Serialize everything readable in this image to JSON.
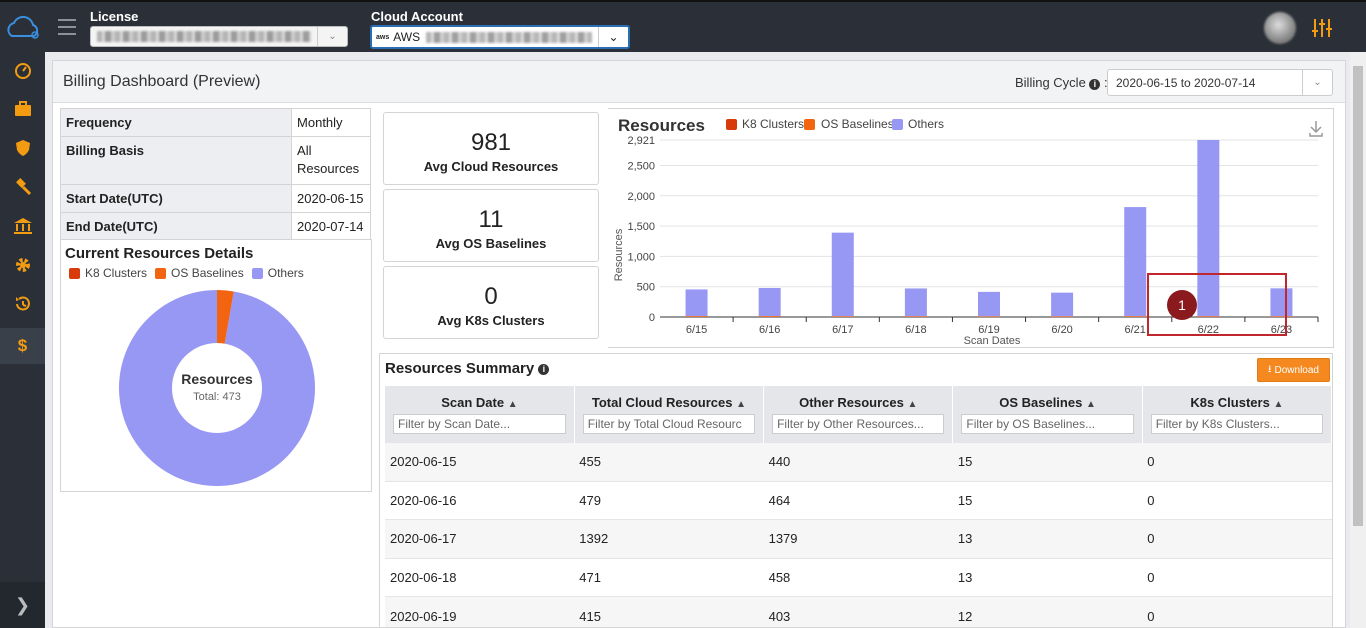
{
  "topbar": {
    "license_label": "License",
    "cloud_account_label": "Cloud Account",
    "cloud_account_value": "AWS"
  },
  "sidebar": {
    "items": [
      {
        "icon": "speedometer-icon"
      },
      {
        "icon": "briefcase-icon"
      },
      {
        "icon": "shield-icon"
      },
      {
        "icon": "gavel-icon"
      },
      {
        "icon": "bank-icon"
      },
      {
        "icon": "gear-icon"
      },
      {
        "icon": "history-icon"
      },
      {
        "icon": "dollar-icon",
        "active": true
      }
    ],
    "collapse_icon": "chevron-right-icon"
  },
  "header": {
    "title": "Billing Dashboard (Preview)",
    "billing_cycle_label": "Billing Cycle",
    "billing_cycle_value": "2020-06-15 to 2020-07-14"
  },
  "info": {
    "frequency_label": "Frequency",
    "frequency_value": "Monthly",
    "basis_label": "Billing Basis",
    "basis_value": "All Resources",
    "start_label": "Start Date(UTC)",
    "start_value": "2020-06-15",
    "end_label": "End Date(UTC)",
    "end_value": "2020-07-14"
  },
  "donut": {
    "title": "Current Resources Details",
    "legend": [
      "K8 Clusters",
      "OS Baselines",
      "Others"
    ],
    "center_title": "Resources",
    "center_sub": "Total: 473"
  },
  "stats": [
    {
      "value": "981",
      "label": "Avg Cloud Resources"
    },
    {
      "value": "11",
      "label": "Avg OS Baselines"
    },
    {
      "value": "0",
      "label": "Avg K8s Clusters"
    }
  ],
  "colors": {
    "k8": "#d83a0c",
    "os": "#f2640f",
    "others": "#9797f4",
    "accent": "#f39c12",
    "download": "#f5891f"
  },
  "chart_data": [
    {
      "type": "bar",
      "title": "Resources",
      "xlabel": "Scan Dates",
      "ylabel": "Resources",
      "categories": [
        "6/15",
        "6/16",
        "6/17",
        "6/18",
        "6/19",
        "6/20",
        "6/21",
        "6/22",
        "6/23"
      ],
      "series": [
        {
          "name": "K8 Clusters",
          "values": [
            0,
            0,
            0,
            0,
            0,
            0,
            0,
            0,
            0
          ]
        },
        {
          "name": "OS Baselines",
          "values": [
            15,
            15,
            13,
            13,
            12,
            12,
            14,
            14,
            13
          ]
        },
        {
          "name": "Others",
          "values": [
            440,
            464,
            1379,
            458,
            403,
            390,
            1800,
            2907,
            460
          ]
        }
      ],
      "yticks": [
        "0",
        "500",
        "1,000",
        "1,500",
        "2,000",
        "2,500",
        "2,921"
      ],
      "ylim": [
        0,
        2921
      ],
      "stacked": true,
      "legend_position": "top"
    },
    {
      "type": "pie",
      "title": "Current Resources Details",
      "categories": [
        "K8 Clusters",
        "OS Baselines",
        "Others"
      ],
      "values": [
        0,
        13,
        460
      ],
      "donut": true
    }
  ],
  "summary": {
    "title": "Resources Summary",
    "download_label": "Download",
    "step_number": "1",
    "columns": [
      "Scan Date",
      "Total Cloud Resources",
      "Other Resources",
      "OS Baselines",
      "K8s Clusters"
    ],
    "filters": [
      "Filter by Scan Date...",
      "Filter by Total Cloud Resourc",
      "Filter by Other Resources...",
      "Filter by OS Baselines...",
      "Filter by K8s Clusters..."
    ],
    "rows": [
      [
        "2020-06-15",
        "455",
        "440",
        "15",
        "0"
      ],
      [
        "2020-06-16",
        "479",
        "464",
        "15",
        "0"
      ],
      [
        "2020-06-17",
        "1392",
        "1379",
        "13",
        "0"
      ],
      [
        "2020-06-18",
        "471",
        "458",
        "13",
        "0"
      ],
      [
        "2020-06-19",
        "415",
        "403",
        "12",
        "0"
      ]
    ]
  }
}
